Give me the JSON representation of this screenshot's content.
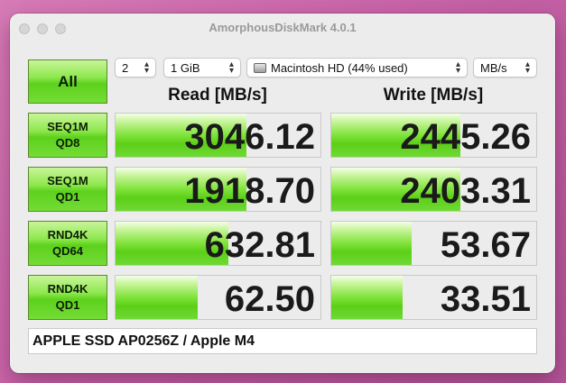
{
  "window": {
    "title": "AmorphousDiskMark 4.0.1"
  },
  "controls": {
    "all_label": "All",
    "count": "2",
    "size": "1 GiB",
    "disk": "Macintosh HD (44% used)",
    "unit": "MB/s"
  },
  "headers": {
    "read": "Read [MB/s]",
    "write": "Write [MB/s]"
  },
  "tests": [
    {
      "line1": "SEQ1M",
      "line2": "QD8",
      "read": "3046.12",
      "write": "2445.26"
    },
    {
      "line1": "SEQ1M",
      "line2": "QD1",
      "read": "1918.70",
      "write": "2403.31"
    },
    {
      "line1": "RND4K",
      "line2": "QD64",
      "read": "632.81",
      "write": "53.67"
    },
    {
      "line1": "RND4K",
      "line2": "QD1",
      "read": "62.50",
      "write": "33.51"
    }
  ],
  "bars": {
    "read": [
      0.64,
      0.64,
      0.55,
      0.4
    ],
    "write": [
      0.63,
      0.63,
      0.39,
      0.35
    ]
  },
  "footer": "APPLE SSD AP0256Z / Apple M4",
  "colors": {
    "accent_green": "#5ccf18",
    "window_bg": "#ececec"
  }
}
